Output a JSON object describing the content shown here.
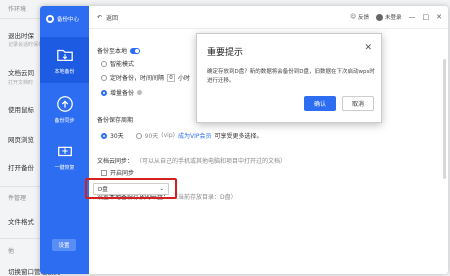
{
  "background": {
    "items": [
      {
        "label": "作环境",
        "style": "grey"
      },
      {
        "label": "退出时保",
        "style": "normal"
      },
      {
        "label": "记录会话时保存",
        "style": "small"
      },
      {
        "label": "文档云同",
        "style": "normal"
      },
      {
        "label": "打开文档时",
        "style": "small"
      },
      {
        "label": "使用鼠标",
        "style": "normal"
      },
      {
        "label": "网页浏览",
        "style": "normal"
      },
      {
        "label": "打开备份",
        "style": "normal"
      },
      {
        "label": "件管理",
        "style": "grey"
      },
      {
        "label": "文件格式",
        "style": "normal"
      },
      {
        "label": "他",
        "style": "grey"
      },
      {
        "label": "切换窗口管理模式",
        "style": "normal"
      }
    ]
  },
  "window": {
    "app_title": "备份中心",
    "nav": [
      {
        "label": "本地备份",
        "icon": "folder-icon",
        "active": true
      },
      {
        "label": "备份同步",
        "icon": "cloud-upload-icon",
        "active": false
      },
      {
        "label": "一键恢复",
        "icon": "restore-icon",
        "active": false
      }
    ],
    "settings_label": "设置",
    "back_label": "返回",
    "feedback_label": "反馈",
    "user_label": "未登录",
    "controls": [
      "—",
      "□",
      "✕"
    ]
  },
  "settings": {
    "backup_to_local": "备份至本地",
    "smart_mode": "智能模式",
    "timed_backup_prefix": "定时备份，时间间隔",
    "timed_interval_value": "0",
    "timed_unit": "小时",
    "incremental_backup": "增量备份",
    "retention_title": "备份保存周期",
    "retention_30": "30天",
    "retention_90": "90天",
    "retention_90_tag": "(vip)",
    "retention_link": "成为VIP会员",
    "retention_more": "可享受更多选择。",
    "cloud_sync_title": "文档云同步：",
    "cloud_sync_desc": "（可以从自己的手机或其他电脑和项目中打开过的文档）",
    "cloud_sync_toggle": "开启同步",
    "drive_title": "设置本地备份存放的磁盘：",
    "drive_desc": "（当前存放目录：D盘）",
    "drive_value": "D盘"
  },
  "modal": {
    "title": "重要提示",
    "body": "确定存放到D盘？新的数据将会备份到D盘，旧数据在下次启动wps时进行迁移。",
    "confirm": "确认",
    "cancel": "取消"
  },
  "colors": {
    "accent": "#2c6df2",
    "highlight": "#d42020"
  }
}
